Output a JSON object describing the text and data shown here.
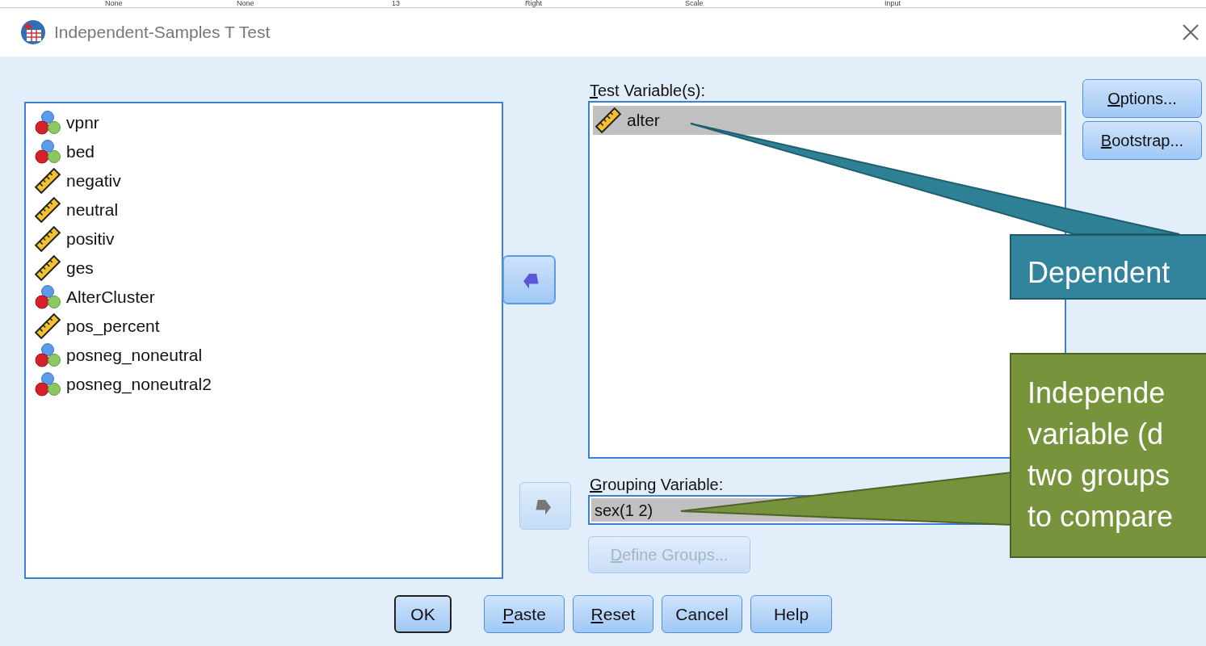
{
  "background_row": [
    "None",
    "None",
    "13",
    "Right",
    "Scale",
    "Input"
  ],
  "window": {
    "title": "Independent-Samples T Test"
  },
  "source_list": [
    {
      "name": "vpnr",
      "kind": "nominal",
      "selected": false
    },
    {
      "name": "bed",
      "kind": "nominal",
      "selected": false
    },
    {
      "name": "negativ",
      "kind": "scale",
      "selected": false
    },
    {
      "name": "neutral",
      "kind": "scale",
      "selected": false
    },
    {
      "name": "positiv",
      "kind": "scale",
      "selected": false
    },
    {
      "name": "ges",
      "kind": "scale",
      "selected": false
    },
    {
      "name": "AlterCluster",
      "kind": "nominal",
      "selected": false
    },
    {
      "name": "pos_percent",
      "kind": "scale",
      "selected": false
    },
    {
      "name": "posneg_noneutral",
      "kind": "nominal",
      "selected": false
    },
    {
      "name": "posneg_noneutral2",
      "kind": "nominal",
      "selected": false
    }
  ],
  "move_buttons": [
    {
      "disabled": false
    },
    {
      "disabled": true
    }
  ],
  "test_variables": {
    "label": {
      "mnemonic": "T",
      "rest": "est Variable(s):"
    },
    "items": [
      {
        "name": "alter",
        "kind": "scale",
        "selected": true
      }
    ]
  },
  "grouping_variable": {
    "label": {
      "mnemonic": "G",
      "rest": "rouping Variable:"
    },
    "value": "sex(1 2)",
    "selected": true
  },
  "define_groups": {
    "label": {
      "mnemonic": "D",
      "rest": "efine Groups..."
    },
    "disabled": true
  },
  "side_buttons": [
    {
      "mnemonic": "O",
      "rest": "ptions..."
    },
    {
      "mnemonic": "B",
      "rest": "ootstrap..."
    }
  ],
  "bottom_buttons": [
    {
      "rest": "OK",
      "default": true
    },
    {
      "mnemonic": "P",
      "rest": "aste",
      "default": false
    },
    {
      "mnemonic": "R",
      "rest": "eset",
      "default": false
    },
    {
      "rest": "Cancel",
      "default": false
    },
    {
      "rest": "Help",
      "default": false
    }
  ],
  "callouts": [
    {
      "kind": "teal",
      "lines": [
        "Dependent"
      ]
    },
    {
      "kind": "green",
      "lines": [
        "Independe",
        "variable (d",
        "two groups",
        "to compare"
      ]
    }
  ]
}
